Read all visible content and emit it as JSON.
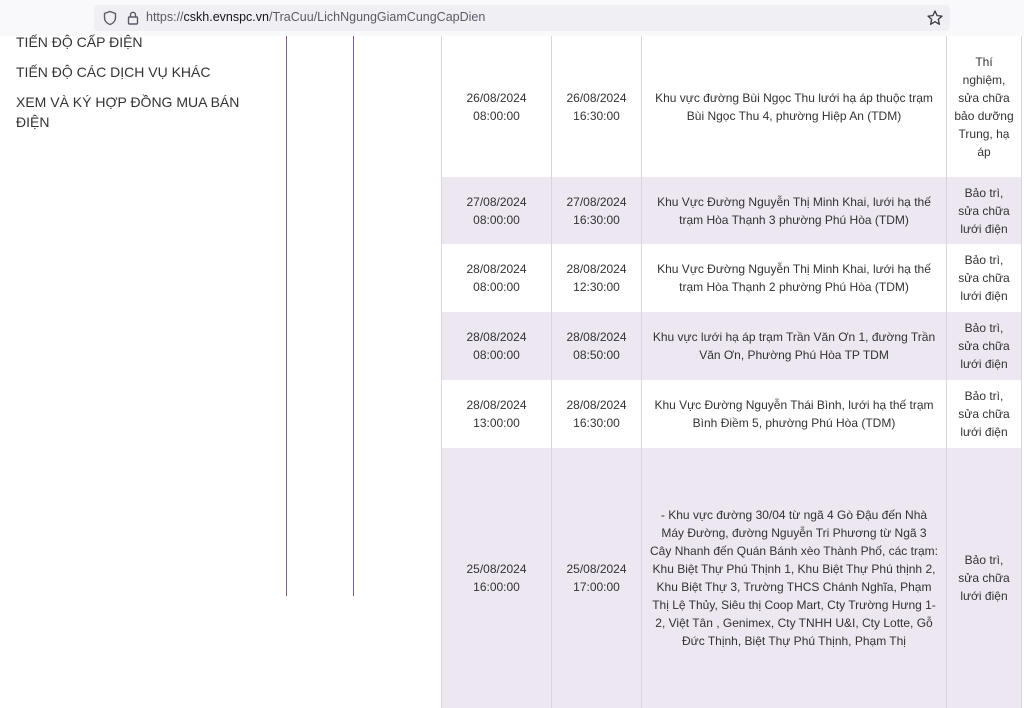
{
  "browser": {
    "url_prefix": "https://",
    "url_host": "cskh.evnspc.vn",
    "url_path": "/TraCuu/LichNgungGiamCungCapDien"
  },
  "sidebar": {
    "items": [
      {
        "label": "TIẾN ĐỘ CẤP ĐIỆN"
      },
      {
        "label": "TIẾN ĐỘ CÁC DỊCH VỤ KHÁC"
      },
      {
        "label": "XEM VÀ KÝ HỢP ĐỒNG MUA BÁN ĐIỆN"
      }
    ]
  },
  "outages": [
    {
      "start_date": "26/08/2024",
      "start_time": "08:00:00",
      "end_date": "26/08/2024",
      "end_time": "16:30:00",
      "area": "Khu vực đường Bùi Ngọc Thu lưới hạ áp thuộc trạm Bùi Ngọc Thu 4, phường Hiệp An (TDM)",
      "reason": "Thí nghiệm, sửa chữa bảo dưỡng Trung, hạ áp"
    },
    {
      "start_date": "27/08/2024",
      "start_time": "08:00:00",
      "end_date": "27/08/2024",
      "end_time": "16:30:00",
      "area": "Khu Vực Đường Nguyễn Thị Minh Khai, lưới hạ thế trạm Hòa Thạnh 3 phường Phú Hòa (TDM)",
      "reason": "Bảo trì, sửa chữa lưới điện"
    },
    {
      "start_date": "28/08/2024",
      "start_time": "08:00:00",
      "end_date": "28/08/2024",
      "end_time": "12:30:00",
      "area": "Khu Vực Đường Nguyễn Thị Minh Khai, lưới hạ thế trạm Hòa Thạnh 2 phường Phú Hòa (TDM)",
      "reason": "Bảo trì, sửa chữa lưới điện"
    },
    {
      "start_date": "28/08/2024",
      "start_time": "08:00:00",
      "end_date": "28/08/2024",
      "end_time": "08:50:00",
      "area": "Khu vực lưới hạ áp trạm Trần Văn Ơn 1, đường Trần Văn Ơn, Phường Phú Hòa TP TDM",
      "reason": "Bảo trì, sửa chữa lưới điện"
    },
    {
      "start_date": "28/08/2024",
      "start_time": "13:00:00",
      "end_date": "28/08/2024",
      "end_time": "16:30:00",
      "area": "Khu Vực Đường Nguyễn Thái Bình, lưới hạ thế trạm Bình Điềm 5, phường Phú Hòa (TDM)",
      "reason": "Bảo trì, sửa chữa lưới điện"
    },
    {
      "start_date": "25/08/2024",
      "start_time": "16:00:00",
      "end_date": "25/08/2024",
      "end_time": "17:00:00",
      "area": "- Khu vực đường 30/04 từ ngã 4 Gò Đậu đến Nhà Máy Đường, đường Nguyễn Tri Phương từ Ngã 3 Cây Nhanh đến Quán Bánh xèo Thành Phố, các trạm: Khu Biệt Thự Phú Thịnh 1, Khu Biệt Thự Phú thịnh 2, Khu Biệt Thự 3, Trường THCS Chánh Nghĩa, Phạm Thị Lệ Thủy, Siêu thị Coop Mart, Cty Trường Hưng 1-2, Việt Tân , Genimex, Cty TNHH U&I, Cty Lotte, Gỗ Đức Thịnh, Biệt Thự Phú Thịnh, Phạm Thị",
      "reason": "Bảo trì, sửa chữa lưới điện"
    }
  ],
  "colors": {
    "column_line": "#7b5c8e",
    "alt_row": "#ece7f0"
  }
}
